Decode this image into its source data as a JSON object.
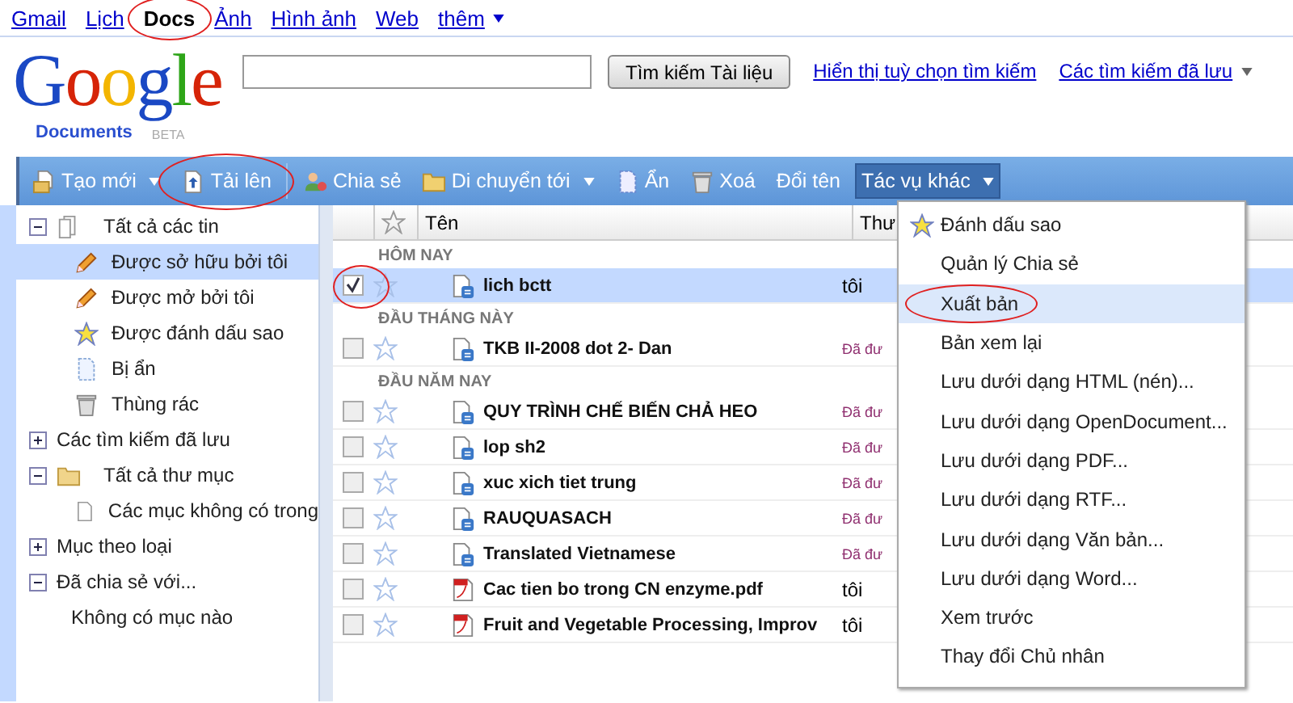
{
  "nav": [
    {
      "label": "Gmail",
      "selected": false
    },
    {
      "label": "Lịch",
      "selected": false
    },
    {
      "label": "Docs",
      "selected": true,
      "circled": true
    },
    {
      "label": "Ảnh",
      "selected": false
    },
    {
      "label": "Hình ảnh",
      "selected": false
    },
    {
      "label": "Web",
      "selected": false
    },
    {
      "label": "thêm",
      "selected": false,
      "dropdown": true
    }
  ],
  "logo": {
    "word": "Google",
    "product": "Documents",
    "badge": "BETA"
  },
  "search": {
    "button": "Tìm kiếm Tài liệu",
    "links": [
      {
        "label": "Hiển thị tuỳ chọn tìm kiếm"
      },
      {
        "label": "Các tìm kiếm đã lưu",
        "dropdown": true
      }
    ]
  },
  "toolbar": [
    {
      "label": "Tạo mới",
      "kind": "new",
      "dropdown": true,
      "open": false,
      "circled": false
    },
    {
      "label": "Tải lên",
      "kind": "upload",
      "dropdown": false,
      "open": false,
      "circled": true
    },
    {
      "label": "Chia sẻ",
      "kind": "share",
      "dropdown": false,
      "open": false,
      "circled": false
    },
    {
      "label": "Di chuyển tới",
      "kind": "move",
      "dropdown": true,
      "open": false,
      "circled": false
    },
    {
      "label": "Ẩn",
      "kind": "hide",
      "dropdown": false,
      "open": false,
      "circled": false
    },
    {
      "label": "Xoá",
      "kind": "delete",
      "dropdown": false,
      "open": false,
      "circled": false
    },
    {
      "label": "Đổi tên",
      "kind": "text",
      "dropdown": false,
      "open": false,
      "circled": false
    },
    {
      "label": "Tác vụ khác",
      "kind": "text",
      "dropdown": true,
      "open": true,
      "circled": false
    }
  ],
  "sidebar": {
    "items": [
      {
        "label": "Tất cả các tin",
        "kind": "docs",
        "expanded": true,
        "selected": false,
        "children": [
          {
            "label": "Được sở hữu bởi tôi",
            "kind": "edit",
            "selected": true
          },
          {
            "label": "Được mở bởi tôi",
            "kind": "edit",
            "selected": false
          },
          {
            "label": "Được đánh dấu sao",
            "kind": "starred",
            "selected": false
          },
          {
            "label": "Bị ẩn",
            "kind": "hidden",
            "selected": false
          },
          {
            "label": "Thùng rác",
            "kind": "trash",
            "selected": false
          }
        ]
      },
      {
        "label": "Các tìm kiếm đã lưu",
        "kind": "text",
        "expanded": false,
        "selected": false
      },
      {
        "label": "Tất cả thư mục",
        "kind": "folders",
        "expanded": true,
        "selected": false,
        "children": [
          {
            "label": "Các mục không có trong",
            "kind": "page",
            "selected": false
          }
        ]
      },
      {
        "label": "Mục theo loại",
        "kind": "text",
        "expanded": false,
        "selected": false
      },
      {
        "label": "Đã chia sẻ với...",
        "kind": "text",
        "expanded": true,
        "selected": false,
        "children": [
          {
            "label": "Không có mục nào",
            "kind": "text",
            "selected": false
          }
        ]
      }
    ]
  },
  "table": {
    "columns": [
      "Tên",
      "Thư"
    ],
    "groups": [
      {
        "title": "HÔM NAY",
        "rows": [
          {
            "name": "lich bctt",
            "kind": "doc",
            "owner": "tôi",
            "shared": false,
            "checked": true,
            "selected": true,
            "circled": true
          }
        ]
      },
      {
        "title": "ĐẦU THÁNG NÀY",
        "rows": [
          {
            "name": "TKB II-2008 dot 2- Dan",
            "kind": "doc",
            "owner": "Đã đư",
            "shared": true,
            "checked": false,
            "selected": false,
            "circled": false
          }
        ]
      },
      {
        "title": "ĐẦU NĂM NAY",
        "rows": [
          {
            "name": "QUY TRÌNH CHẾ BIẾN CHẢ HEO",
            "kind": "doc",
            "owner": "Đã đư",
            "shared": true,
            "checked": false,
            "selected": false,
            "circled": false
          },
          {
            "name": "lop sh2",
            "kind": "doc",
            "owner": "Đã đư",
            "shared": true,
            "checked": false,
            "selected": false,
            "circled": false
          },
          {
            "name": "xuc xich tiet trung",
            "kind": "doc",
            "owner": "Đã đư",
            "shared": true,
            "checked": false,
            "selected": false,
            "circled": false
          },
          {
            "name": "RAUQUASACH",
            "kind": "doc",
            "owner": "Đã đư",
            "shared": true,
            "checked": false,
            "selected": false,
            "circled": false
          },
          {
            "name": "Translated Vietnamese",
            "kind": "doc",
            "owner": "Đã đư",
            "shared": true,
            "checked": false,
            "selected": false,
            "circled": false
          },
          {
            "name": "Cac tien bo trong CN enzyme.pdf",
            "kind": "pdf",
            "owner": "tôi",
            "shared": false,
            "checked": false,
            "selected": false,
            "circled": false
          },
          {
            "name": "Fruit and Vegetable Processing, Improv",
            "kind": "pdf",
            "owner": "tôi",
            "shared": false,
            "checked": false,
            "selected": false,
            "circled": false
          }
        ]
      }
    ]
  },
  "menu": {
    "items": [
      {
        "label": "Đánh dấu sao",
        "kind": "starred",
        "selected": false,
        "circled": false
      },
      {
        "label": "Quản lý Chia sẻ",
        "kind": "text",
        "selected": false,
        "circled": false
      },
      {
        "label": "Xuất bản",
        "kind": "text",
        "selected": true,
        "circled": true
      },
      {
        "label": "Bản xem lại",
        "kind": "text",
        "selected": false,
        "circled": false
      },
      {
        "label": "Lưu dưới dạng HTML (nén)...",
        "kind": "text",
        "selected": false,
        "circled": false
      },
      {
        "label": "Lưu dưới dạng OpenDocument...",
        "kind": "text",
        "selected": false,
        "circled": false
      },
      {
        "label": "Lưu dưới dạng PDF...",
        "kind": "text",
        "selected": false,
        "circled": false
      },
      {
        "label": "Lưu dưới dạng RTF...",
        "kind": "text",
        "selected": false,
        "circled": false
      },
      {
        "label": "Lưu dưới dạng Văn bản...",
        "kind": "text",
        "selected": false,
        "circled": false
      },
      {
        "label": "Lưu dưới dạng Word...",
        "kind": "text",
        "selected": false,
        "circled": false
      },
      {
        "label": "Xem trước",
        "kind": "text",
        "selected": false,
        "circled": false
      },
      {
        "label": "Thay đổi Chủ nhân",
        "kind": "text",
        "selected": false,
        "circled": false
      }
    ]
  }
}
